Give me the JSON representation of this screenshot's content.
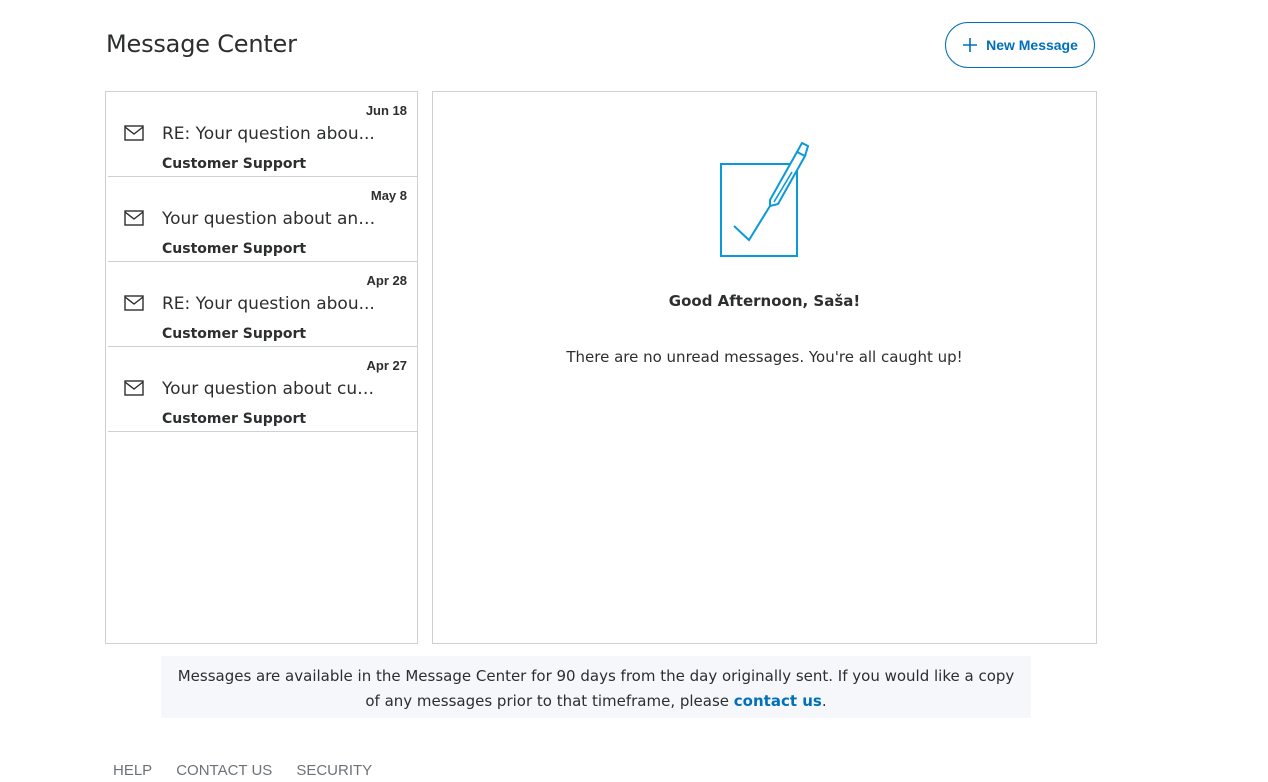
{
  "header": {
    "title": "Message Center",
    "new_message_label": "New Message"
  },
  "messages": [
    {
      "date": "Jun 18",
      "subject": "RE: Your question abou...",
      "sender": "Customer Support"
    },
    {
      "date": "May 8",
      "subject": "Your question about an ...",
      "sender": "Customer Support"
    },
    {
      "date": "Apr 28",
      "subject": "RE: Your question abou...",
      "sender": "Customer Support"
    },
    {
      "date": "Apr 27",
      "subject": "Your question about cur...",
      "sender": "Customer Support"
    }
  ],
  "detail": {
    "greeting": "Good Afternoon, Saša!",
    "no_unread": "There are no unread messages. You're all caught up!",
    "illustration_icon": "checklist-pen-icon"
  },
  "notice": {
    "text": "Messages are available in the Message Center for 90 days from the day originally sent. If you would like a copy of any messages prior to that timeframe, please ",
    "link": "contact us",
    "suffix": "."
  },
  "footer": {
    "links": [
      "HELP",
      "CONTACT US",
      "SECURITY"
    ]
  },
  "colors": {
    "accent": "#0070ba",
    "illustration": "#0b9ad8",
    "border": "#cbd2d6",
    "notice_bg": "#f5f7fa"
  }
}
